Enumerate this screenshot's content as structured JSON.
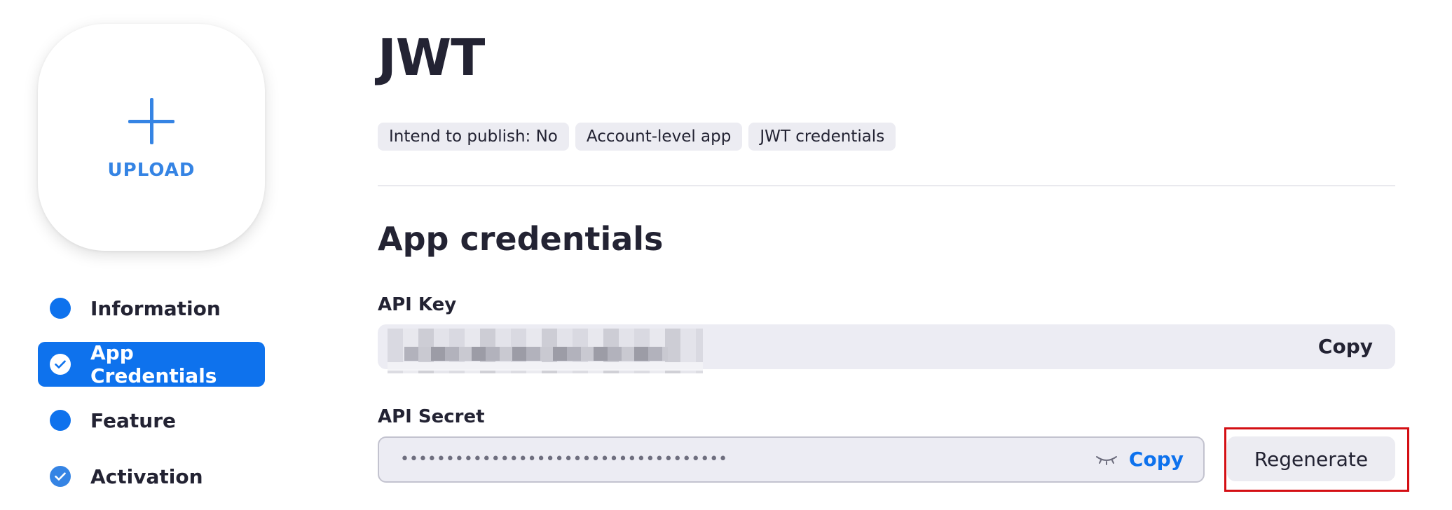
{
  "sidebar": {
    "upload_label": "UPLOAD",
    "items": [
      {
        "label": "Information",
        "state": "default",
        "icon": "dot-icon"
      },
      {
        "label": "App Credentials",
        "state": "active",
        "icon": "check-circle-icon"
      },
      {
        "label": "Feature",
        "state": "default",
        "icon": "dot-icon"
      },
      {
        "label": "Activation",
        "state": "done",
        "icon": "check-circle-icon"
      }
    ]
  },
  "main": {
    "title": "JWT",
    "tags": [
      "Intend to publish: No",
      "Account-level app",
      "JWT credentials"
    ],
    "section_title": "App credentials",
    "api_key": {
      "label": "API Key",
      "value_redacted": true,
      "copy_label": "Copy"
    },
    "api_secret": {
      "label": "API Secret",
      "masked_value": "••••••••••••••••••••••••••••••••••••",
      "copy_label": "Copy",
      "regenerate_label": "Regenerate",
      "eye_icon": "eye-closed-icon"
    }
  },
  "colors": {
    "primary_blue": "#0e72ed",
    "upload_blue": "#3584e4",
    "text_dark": "#232333",
    "field_bg": "#ececf3",
    "highlight_red": "#d40f14"
  }
}
